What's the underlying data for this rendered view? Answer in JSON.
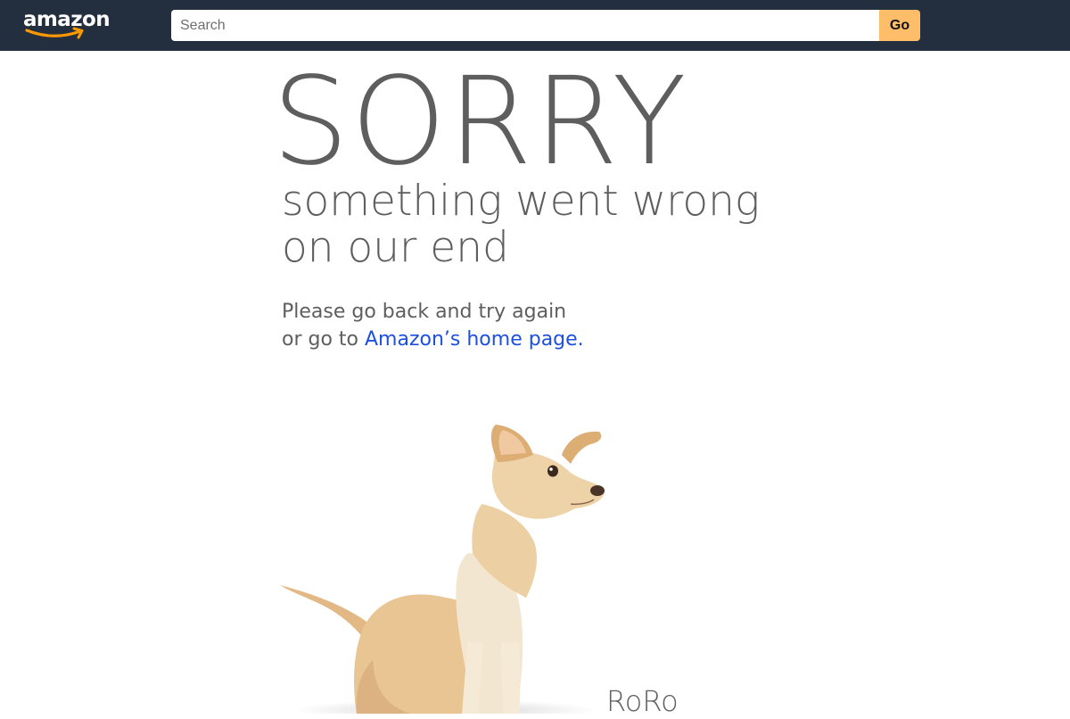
{
  "header": {
    "logo_text": "amazon",
    "search": {
      "placeholder": "Search",
      "value": ""
    },
    "go_label": "Go"
  },
  "error": {
    "headline": "SORRY",
    "subhead_line1": "something went wrong",
    "subhead_line2": "on our end",
    "message_line1": "Please go back and try again",
    "message_line2_prefix": "or go to ",
    "home_link": "Amazon’s home page."
  },
  "dog": {
    "name": "RoRo"
  },
  "colors": {
    "header_bg": "#232f3e",
    "go_button": "#febd69",
    "smile": "#ff9900",
    "text": "#5e5e5e",
    "link": "#1d4fe0"
  },
  "icons": [
    "amazon-logo",
    "dog-photo"
  ]
}
